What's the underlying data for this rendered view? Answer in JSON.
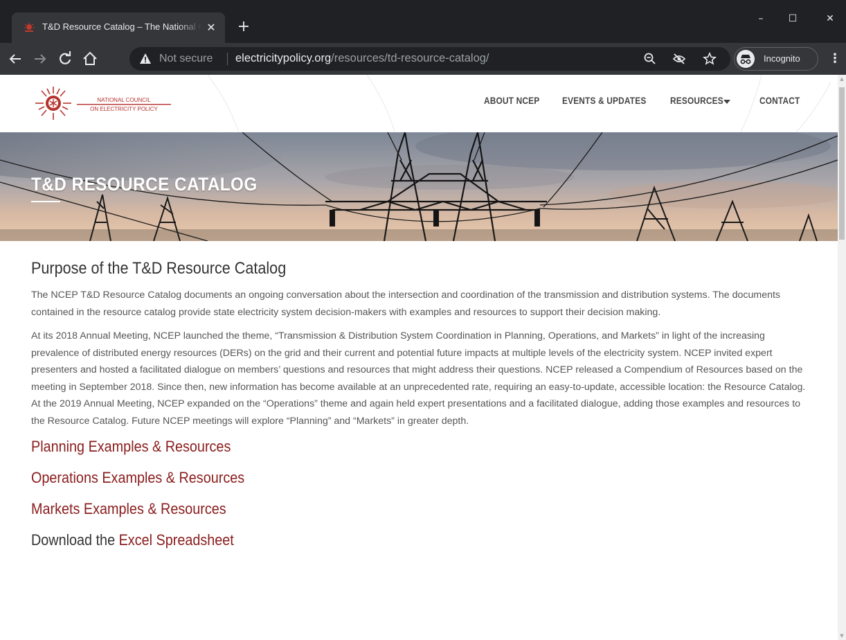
{
  "browser": {
    "tab_title": "T&D Resource Catalog – The National Council on Electricity Policy",
    "tab_close": "✕",
    "new_tab": "+",
    "not_secure_label": "Not secure",
    "url_host": "electricitypolicy.org",
    "url_path": "/resources/td-resource-catalog/",
    "incognito_label": "Incognito",
    "window_controls": {
      "minimize": "–",
      "maximize": "☐",
      "close": "✕"
    }
  },
  "site": {
    "logo_text_line1": "NATIONAL COUNCIL",
    "logo_text_line2": "ON ELECTRICITY POLICY",
    "nav": [
      {
        "label": "ABOUT NCEP"
      },
      {
        "label": "EVENTS & UPDATES"
      },
      {
        "label": "RESOURCES"
      },
      {
        "label": "CONTACT"
      }
    ],
    "accent_color": "#8a1c1c"
  },
  "hero": {
    "title": "T&D RESOURCE CATALOG"
  },
  "content": {
    "heading": "Purpose of the T&D Resource Catalog",
    "paragraphs": [
      "The NCEP T&D Resource Catalog documents an ongoing conversation about the intersection and coordination of the transmission and distribution systems. The documents contained in the resource catalog provide state electricity system decision-makers with examples and resources to support their decision making.",
      "At its 2018 Annual Meeting, NCEP launched the theme, “Transmission & Distribution System Coordination in Planning, Operations, and Markets” in light of the increasing prevalence of distributed energy resources (DERs) on the grid and their current and potential future impacts at multiple levels of the electricity system. NCEP invited expert presenters and hosted a facilitated dialogue on members’ questions and resources that might address their questions. NCEP released a Compendium of Resources based on the meeting in September 2018. Since then, new information has become available at an unprecedented rate, requiring an easy-to-update, accessible location: the Resource Catalog. At the 2019 Annual Meeting, NCEP expanded on the “Operations” theme and again held expert presentations and a facilitated dialogue, adding those examples and resources to the Resource Catalog. Future NCEP meetings will explore “Planning” and “Markets” in greater depth."
    ],
    "links": [
      {
        "label": "Planning Examples & Resources"
      },
      {
        "label": "Operations Examples & Resources"
      },
      {
        "label": "Markets Examples & Resources"
      }
    ],
    "download_prefix": "Download the ",
    "download_link": "Excel Spreadsheet"
  }
}
